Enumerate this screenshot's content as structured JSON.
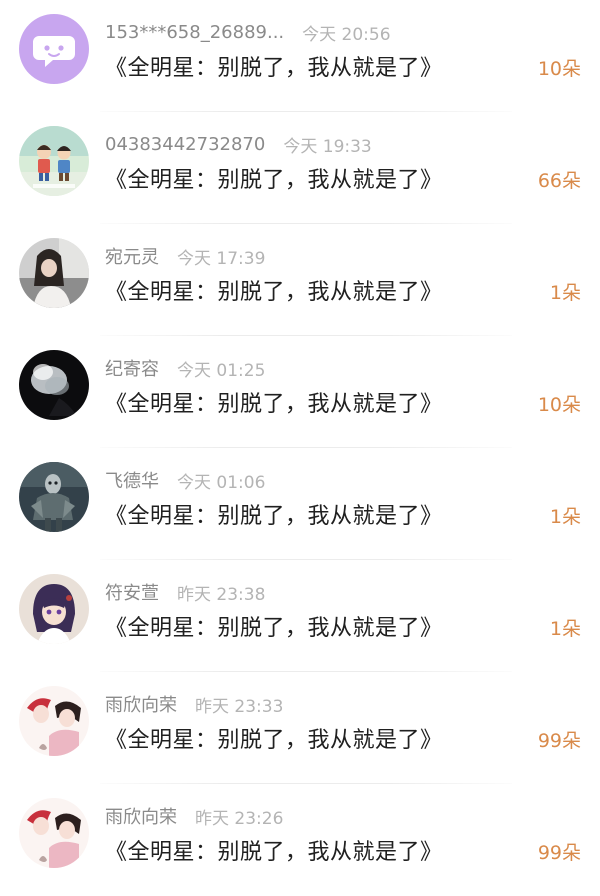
{
  "gift_list": {
    "items": [
      {
        "name": "153***658_26889...",
        "time": "今天 20:56",
        "title": "《全明星：别脱了，我从就是了》",
        "count": "10朵",
        "avatar": "default-chat-avatar"
      },
      {
        "name": "04383442732870",
        "time": "今天 19:33",
        "title": "《全明星：别脱了，我从就是了》",
        "count": "66朵",
        "avatar": "cartoon-kids-avatar"
      },
      {
        "name": "宛元灵",
        "time": "今天 17:39",
        "title": "《全明星：别脱了，我从就是了》",
        "count": "1朵",
        "avatar": "girl-photo-avatar"
      },
      {
        "name": "纪寄容",
        "time": "今天 01:25",
        "title": "《全明星：别脱了，我从就是了》",
        "count": "10朵",
        "avatar": "smoke-dark-avatar"
      },
      {
        "name": "飞德华",
        "time": "今天 01:06",
        "title": "《全明星：别脱了，我从就是了》",
        "count": "1朵",
        "avatar": "armored-warrior-avatar"
      },
      {
        "name": "符安萱",
        "time": "昨天 23:38",
        "title": "《全明星：别脱了，我从就是了》",
        "count": "1朵",
        "avatar": "anime-girl-avatar"
      },
      {
        "name": "雨欣向荣",
        "time": "昨天 23:33",
        "title": "《全明星：别脱了，我从就是了》",
        "count": "99朵",
        "avatar": "anime-couple-avatar"
      },
      {
        "name": "雨欣向荣",
        "time": "昨天 23:26",
        "title": "《全明星：别脱了，我从就是了》",
        "count": "99朵",
        "avatar": "anime-couple-avatar"
      }
    ]
  },
  "colors": {
    "name": "#8a8a8a",
    "time": "#b4b4b4",
    "title": "#202020",
    "count": "#d98a4a",
    "default_avatar_bg": "#c9a8f0"
  }
}
